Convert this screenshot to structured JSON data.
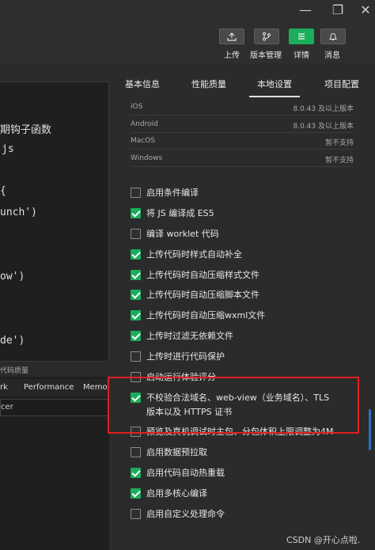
{
  "window": {
    "minimize_label": "—",
    "restore_label": "❐",
    "close_label": "✕"
  },
  "toolbar": {
    "upload_label": "上传",
    "version_label": "版本管理",
    "details_label": "详情",
    "messages_label": "消息"
  },
  "editor": {
    "lines": [
      "期钩子函数",
      "js",
      "{",
      "unch')",
      "ow')",
      "de')"
    ],
    "panel_title": "代码质量",
    "panel_tabs": [
      "rk",
      "Performance",
      "Memor"
    ],
    "filter_text": "cer"
  },
  "tabs": [
    "基本信息",
    "性能质量",
    "本地设置",
    "项目配置"
  ],
  "versions": [
    {
      "os": "iOS",
      "value": "8.0.43 及以上版本"
    },
    {
      "os": "Android",
      "value": "8.0.43 及以上版本"
    },
    {
      "os": "MacOS",
      "value": "暂不支持"
    },
    {
      "os": "Windows",
      "value": "暂不支持"
    }
  ],
  "options": [
    {
      "label": "启用条件编译",
      "checked": false
    },
    {
      "label": "将 JS 编译成 ES5",
      "checked": true
    },
    {
      "label": "编译 worklet 代码",
      "checked": false
    },
    {
      "label": "上传代码时样式自动补全",
      "checked": true
    },
    {
      "label": "上传代码时自动压缩样式文件",
      "checked": true
    },
    {
      "label": "上传代码时自动压缩脚本文件",
      "checked": true
    },
    {
      "label": "上传代码时自动压缩wxml文件",
      "checked": true
    },
    {
      "label": "上传时过滤无依赖文件",
      "checked": true
    },
    {
      "label": "上传时进行代码保护",
      "checked": false
    },
    {
      "label": "启动运行体验评分",
      "checked": false
    },
    {
      "label": "不校验合法域名、web-view（业务域名）、TLS",
      "label2": "版本以及 HTTPS 证书",
      "checked": true
    },
    {
      "label": "预览及真机调试时主包、分包体积上限调整为4M",
      "checked": false
    },
    {
      "label": "启用数据预拉取",
      "checked": false
    },
    {
      "label": "启用代码自动热重载",
      "checked": true
    },
    {
      "label": "启用多核心编译",
      "checked": true
    },
    {
      "label": "启用自定义处理命令",
      "checked": false
    }
  ],
  "watermark": "CSDN @开心点啦.",
  "colors": {
    "accent": "#1aad5c",
    "highlight": "#e02020"
  }
}
